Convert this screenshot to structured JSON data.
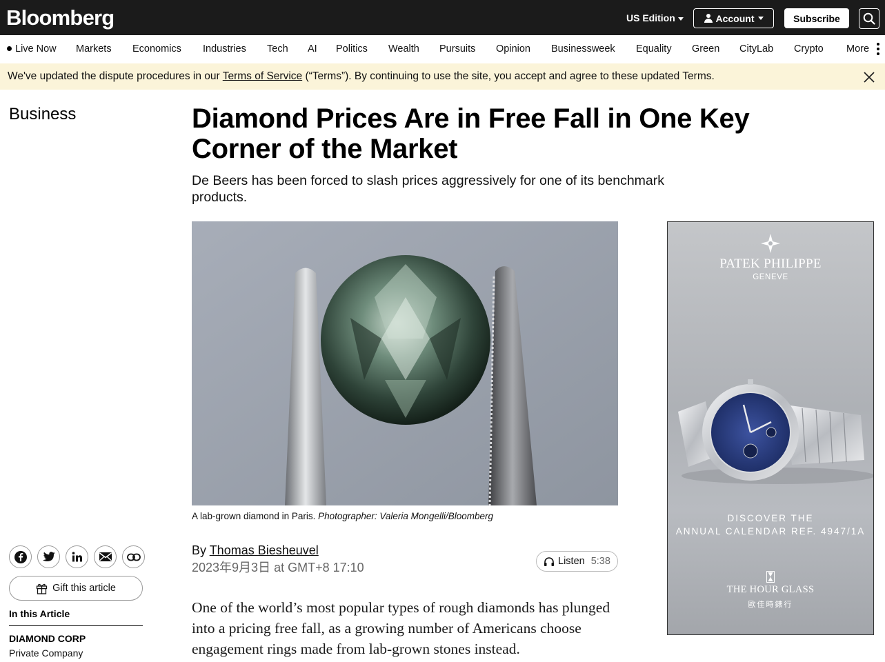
{
  "header": {
    "logo": "Bloomberg",
    "edition": "US Edition",
    "account": "Account",
    "subscribe": "Subscribe"
  },
  "nav": {
    "items": [
      "Live Now",
      "Markets",
      "Economics",
      "Industries",
      "Tech",
      "AI",
      "Politics",
      "Wealth",
      "Pursuits",
      "Opinion",
      "Businessweek",
      "Equality",
      "Green",
      "CityLab",
      "Crypto",
      "More"
    ]
  },
  "banner": {
    "text_before": "We've updated the dispute procedures in our ",
    "link": "Terms of Service",
    "text_after": " (“Terms”). By continuing to use the site, you accept and agree to these updated Terms."
  },
  "article": {
    "section": "Business",
    "headline": "Diamond Prices Are in Free Fall in One Key Corner of the Market",
    "dek": "De Beers has been forced to slash prices aggressively for one of its benchmark products.",
    "caption_text": "A lab-grown diamond in Paris. ",
    "caption_credit": "Photographer: Valeria Mongelli/Bloomberg",
    "by_prefix": "By ",
    "author": "Thomas Biesheuvel",
    "date": "2023年9月3日 at GMT+8 17:10",
    "listen_label": "Listen",
    "listen_duration": "5:38",
    "body_first_paragraph": "One of the world’s most popular types of rough diamonds has plunged into a pricing free fall, as a growing number of Americans choose engagement rings made from lab-grown stones instead."
  },
  "sidebar": {
    "gift_label": "Gift this article",
    "in_article_heading": "In this Article",
    "company_name": "DIAMOND CORP",
    "company_type": "Private Company"
  },
  "ad": {
    "brand": "PATEK PHILIPPE",
    "brand_sub": "GENEVE",
    "tagline_1": "DISCOVER THE",
    "tagline_2": "ANNUAL CALENDAR REF. 4947/1A",
    "retailer": "THE HOUR GLASS",
    "retailer_cn": "歐佳時錶行"
  },
  "colors": {
    "topbar_bg": "#1b1b1b",
    "banner_bg": "#fbf4d9",
    "ad_dial_blue": "#2a3d7a"
  }
}
